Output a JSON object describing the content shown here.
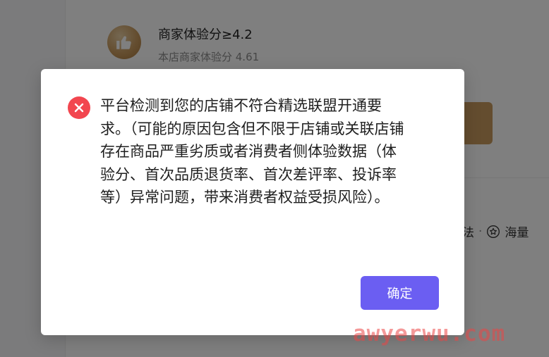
{
  "background": {
    "merchant_score_title": "商家体验分≥4.2",
    "merchant_score_sub": "本店商家体验分 4.61",
    "footer_text_1": "法",
    "footer_dot": "·",
    "footer_text_2": "海量"
  },
  "dialog": {
    "message": "平台检测到您的店铺不符合精选联盟开通要求。（可能的原因包含但不限于店铺或关联店铺存在商品严重劣质或者消费者侧体验数据（体验分、首次品质退货率、首次差评率、投诉率等）异常问题，带来消费者权益受损风险）。",
    "confirm_label": "确定"
  },
  "watermark": "awyerwu.com",
  "colors": {
    "error": "#f2464f",
    "primary": "#6b5ef2",
    "badge_gold": "#c89a5e"
  },
  "icons": {
    "error": "close-circle-icon",
    "merchant": "thumbs-up-icon",
    "footer": "star-badge-icon"
  }
}
